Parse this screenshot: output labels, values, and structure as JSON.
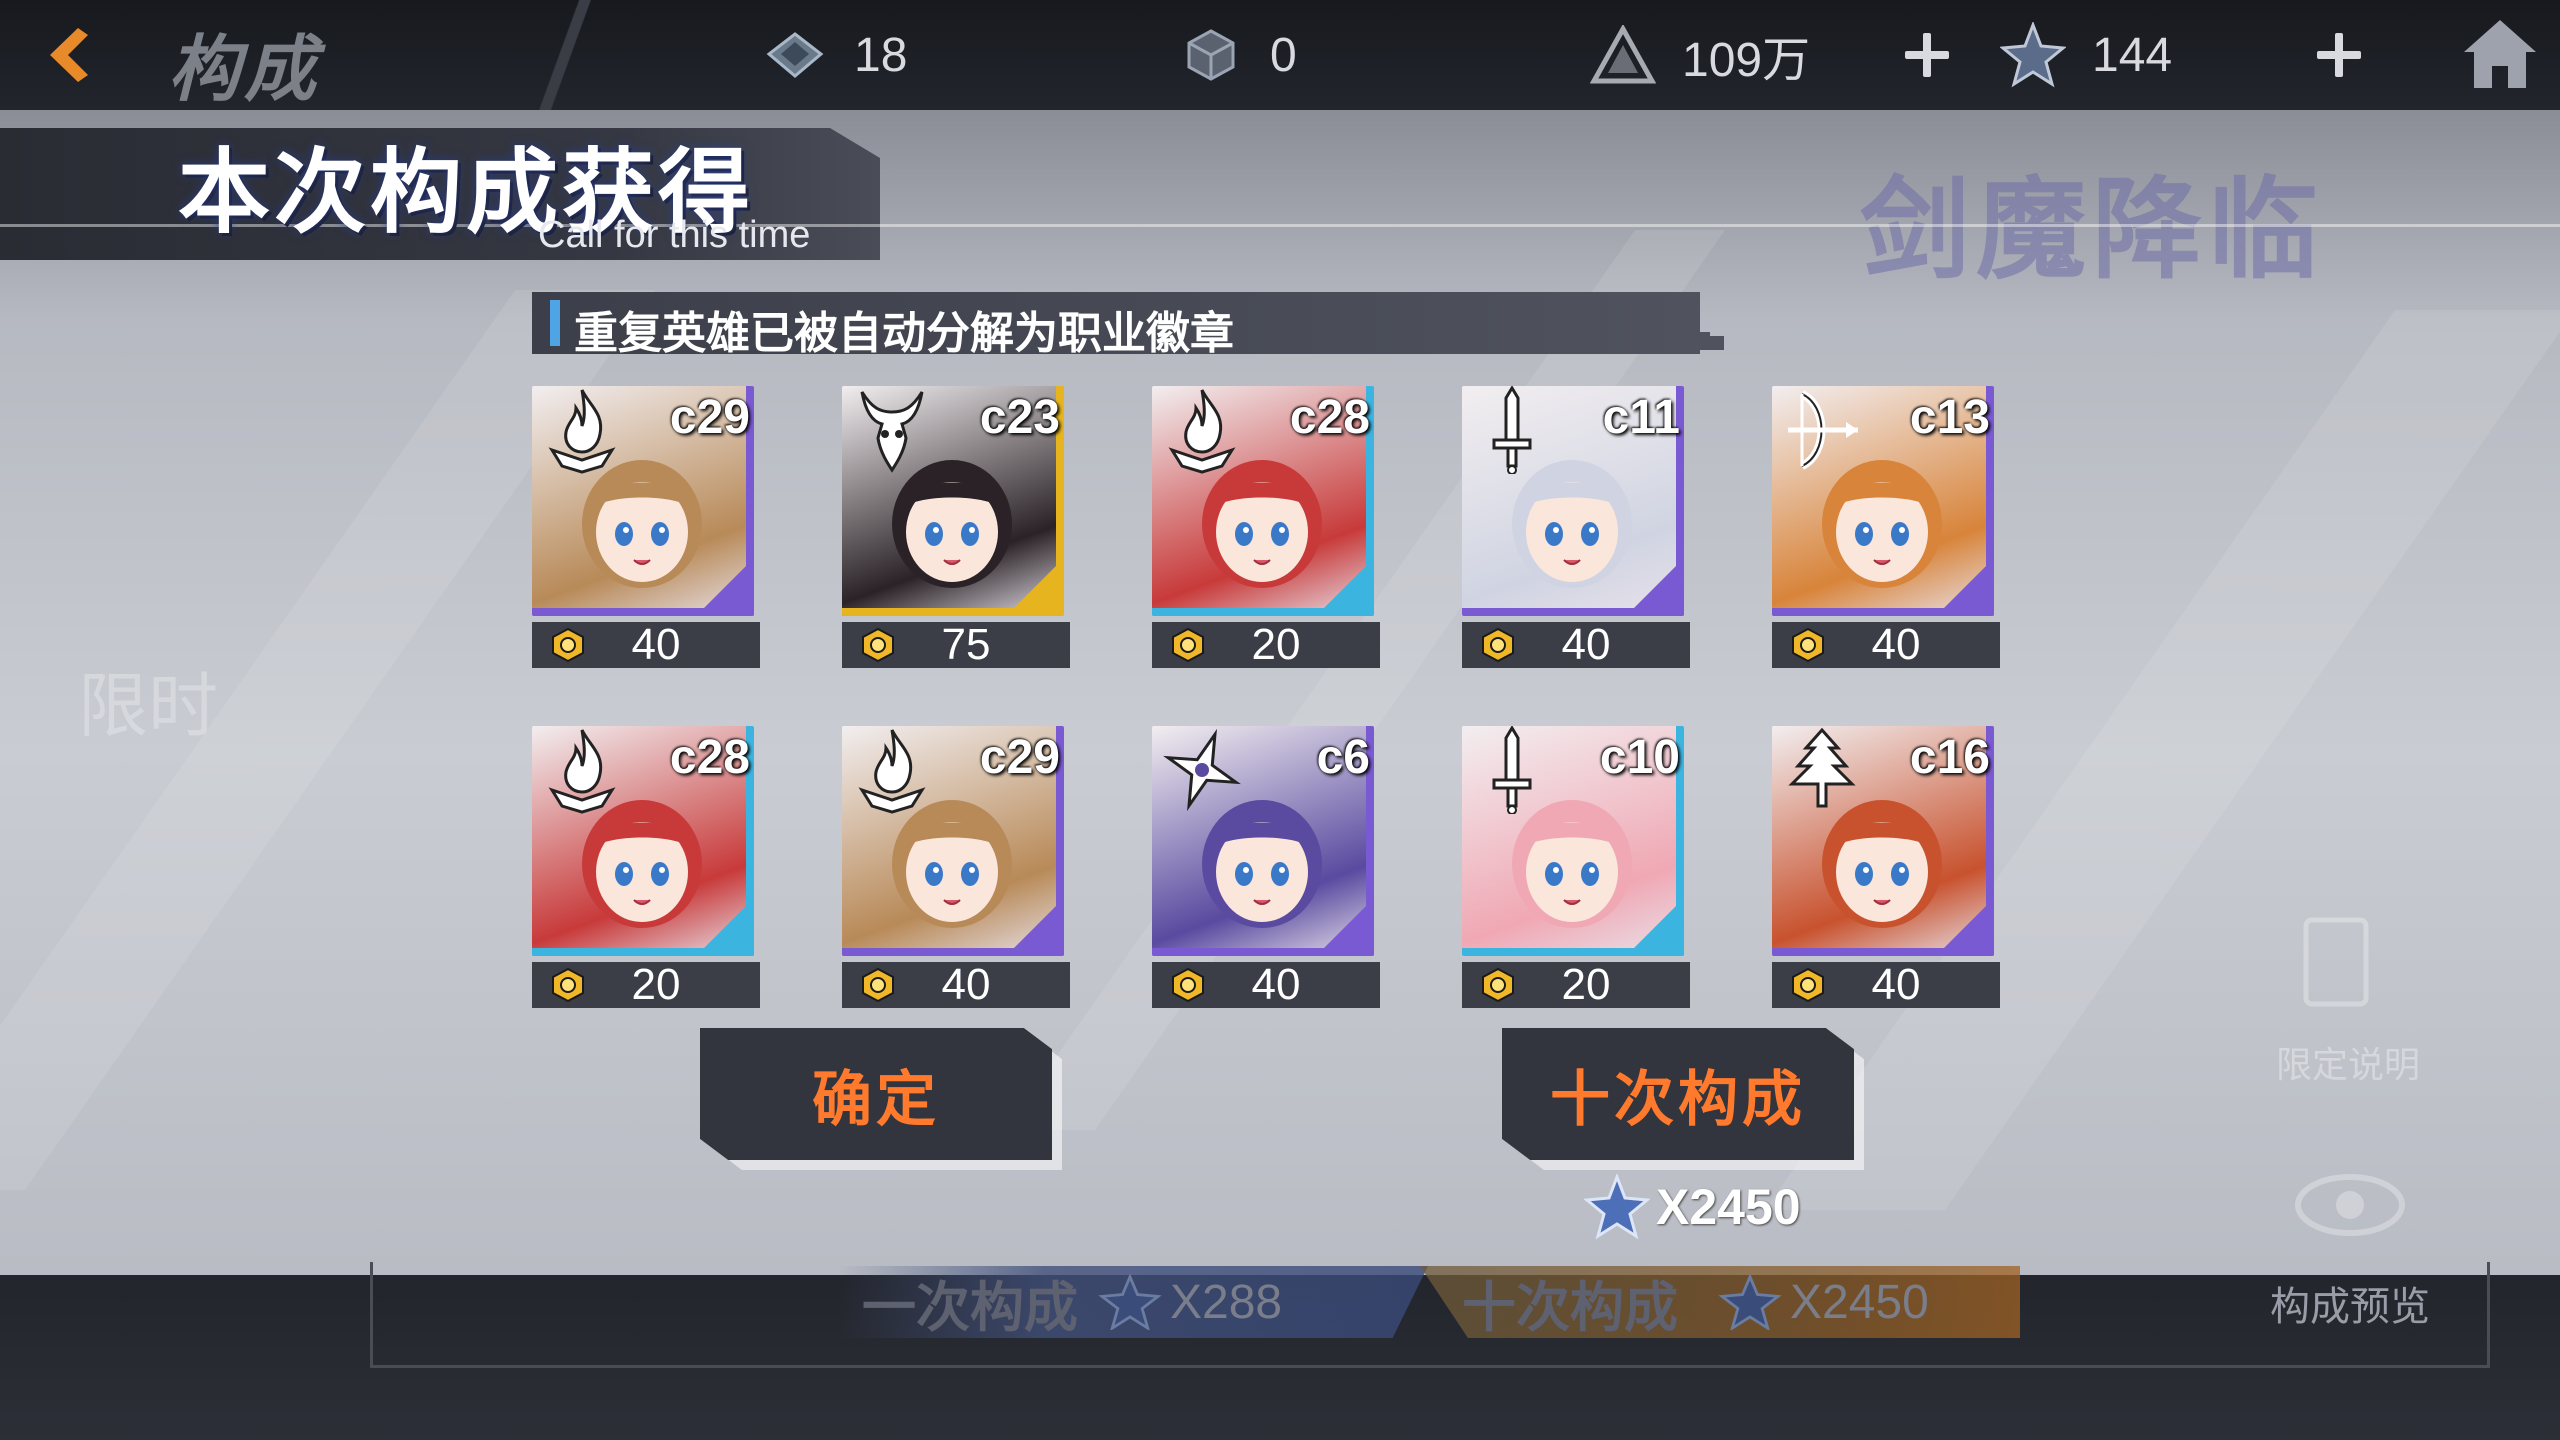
{
  "topbar": {
    "title": "构成",
    "resources": [
      {
        "name": "crystal",
        "icon": "crystal-icon",
        "value": "18"
      },
      {
        "name": "cube",
        "icon": "cube-icon",
        "value": "0"
      },
      {
        "name": "gold",
        "icon": "triangle-coin-icon",
        "value": "109万"
      },
      {
        "name": "star",
        "icon": "star-crystal-icon",
        "value": "144"
      }
    ]
  },
  "background": {
    "deco_title": "剑魔降临",
    "limited_label": "限时",
    "limited_desc": "限定说明",
    "preview": "构成预览"
  },
  "dialog": {
    "title": "本次构成获得",
    "subtitle": "Call for this time",
    "notice": "重复英雄已被自动分解为职业徽章",
    "heroes": [
      {
        "level": "c29",
        "reward": "40",
        "class_icon": "flame-icon",
        "color": "#7a5ad2",
        "accent": "#b88a58"
      },
      {
        "level": "c23",
        "reward": "75",
        "class_icon": "demon-icon",
        "color": "#e6b41e",
        "accent": "#2a2226"
      },
      {
        "level": "c28",
        "reward": "20",
        "class_icon": "flame-icon",
        "color": "#3cb4e0",
        "accent": "#c83a3a"
      },
      {
        "level": "c11",
        "reward": "40",
        "class_icon": "sword-icon",
        "color": "#7a5ad2",
        "accent": "#d0d4e2"
      },
      {
        "level": "c13",
        "reward": "40",
        "class_icon": "bow-icon",
        "color": "#7a5ad2",
        "accent": "#d8843a"
      },
      {
        "level": "c28",
        "reward": "20",
        "class_icon": "flame-icon",
        "color": "#3cb4e0",
        "accent": "#c83a3a"
      },
      {
        "level": "c29",
        "reward": "40",
        "class_icon": "flame-icon",
        "color": "#7a5ad2",
        "accent": "#b88a58"
      },
      {
        "level": "c6",
        "reward": "40",
        "class_icon": "shuriken-icon",
        "color": "#7a5ad2",
        "accent": "#5a4aa0"
      },
      {
        "level": "c10",
        "reward": "20",
        "class_icon": "sword-icon",
        "color": "#3cb4e0",
        "accent": "#f0a8b4"
      },
      {
        "level": "c16",
        "reward": "40",
        "class_icon": "tree-icon",
        "color": "#7a5ad2",
        "accent": "#c8522e"
      }
    ],
    "confirm_label": "确定",
    "ten_call_label": "十次构成",
    "ten_call_cost": "X2450"
  },
  "bottom": {
    "one_call_label": "一次构成",
    "one_call_cost": "X288",
    "ten_call_label": "十次构成",
    "ten_call_cost": "X2450"
  },
  "colors": {
    "accent_orange": "#ff7a2c",
    "notice_bar": "#4fa4e6",
    "rarity_purple": "#7a5ad2",
    "rarity_gold": "#e6b41e",
    "rarity_blue": "#3cb4e0"
  }
}
